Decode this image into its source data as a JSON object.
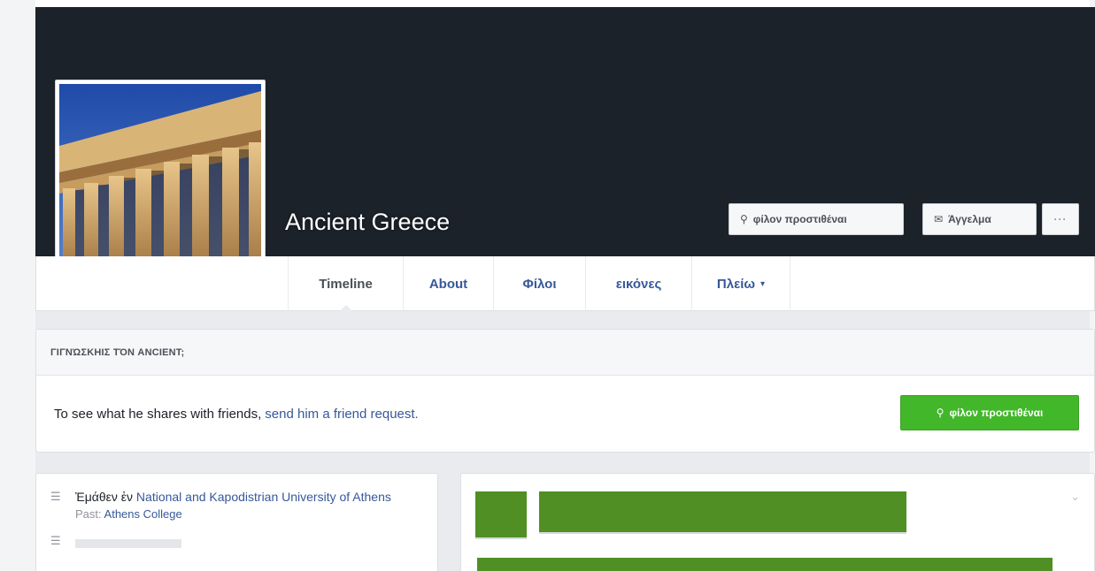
{
  "profile": {
    "name": "Ancient Greece",
    "add_friend_label": "φίλον προστιθέναι",
    "message_label": "Άγγελμα",
    "more_label": "···"
  },
  "nav": {
    "tabs": [
      {
        "label": "Timeline"
      },
      {
        "label": "About"
      },
      {
        "label": "Φίλοι"
      },
      {
        "label": "εικόνες"
      },
      {
        "label": "Πλείω"
      }
    ],
    "more_caret": "▾"
  },
  "know": {
    "header": "ΓΙΓΝΏΣΚΗΙΣ ΤΌΝ ANCIENT;",
    "text": "To see what he shares with friends,",
    "link": "send him a friend request.",
    "button_label": "φίλον προστιθέναι"
  },
  "intro": {
    "prefix": "Ἐμάθεν ἐν",
    "school": "National and Kapodistrian University of Athens",
    "past_label": "Past:",
    "past_school": "Athens College"
  },
  "icons": {
    "add_friend": "person-plus-icon",
    "message": "message-icon",
    "education": "education-icon",
    "chevron": "chevron-down-icon"
  },
  "colors": {
    "cover": "#1c222a",
    "link": "#365899",
    "green_button": "#42b72a",
    "post_placeholder": "#4f8f23"
  }
}
